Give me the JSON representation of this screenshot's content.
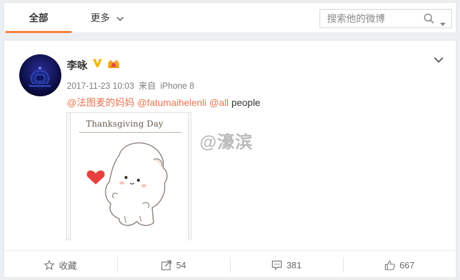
{
  "topbar": {
    "tab_all": "全部",
    "tab_more": "更多",
    "search_placeholder": "搜索他的微博"
  },
  "post": {
    "username": "李咏",
    "timestamp": "2017-11-23 10:03",
    "source_prefix": "来自",
    "device": "iPhone 8",
    "mentions": [
      "@法图麦的妈妈",
      "@fatumaihelenli",
      "@all"
    ],
    "text_suffix": "people",
    "image_caption": "Thanksgiving Day",
    "watermark": "@濠滨"
  },
  "actions": {
    "favorite_label": "收藏",
    "repost_count": "54",
    "comment_count": "381",
    "like_count": "667"
  },
  "colors": {
    "accent": "#fa7d3c",
    "mention": "#eb7350",
    "verified_badge": "#f5b400",
    "heart": "#e8413d"
  }
}
